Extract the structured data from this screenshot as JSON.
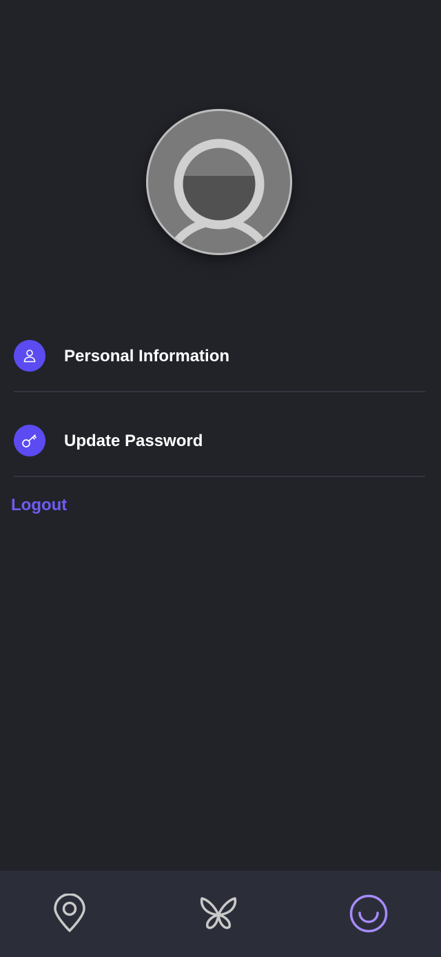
{
  "profile": {
    "avatar_icon": "default-user-avatar"
  },
  "menu": {
    "items": [
      {
        "label": "Personal Information",
        "icon": "user-icon"
      },
      {
        "label": "Update Password",
        "icon": "key-icon"
      }
    ],
    "logout_label": "Logout"
  },
  "bottom_nav": {
    "items": [
      {
        "icon": "map-pin-icon",
        "active": false
      },
      {
        "icon": "butterfly-icon",
        "active": false
      },
      {
        "icon": "smile-icon",
        "active": true
      }
    ]
  },
  "colors": {
    "background": "#212329",
    "accent": "#5b4bf0",
    "logout": "#6f5cf2",
    "nav_background": "#2b2e39",
    "nav_active": "#a78bfa",
    "nav_inactive": "#c9c9c9"
  }
}
